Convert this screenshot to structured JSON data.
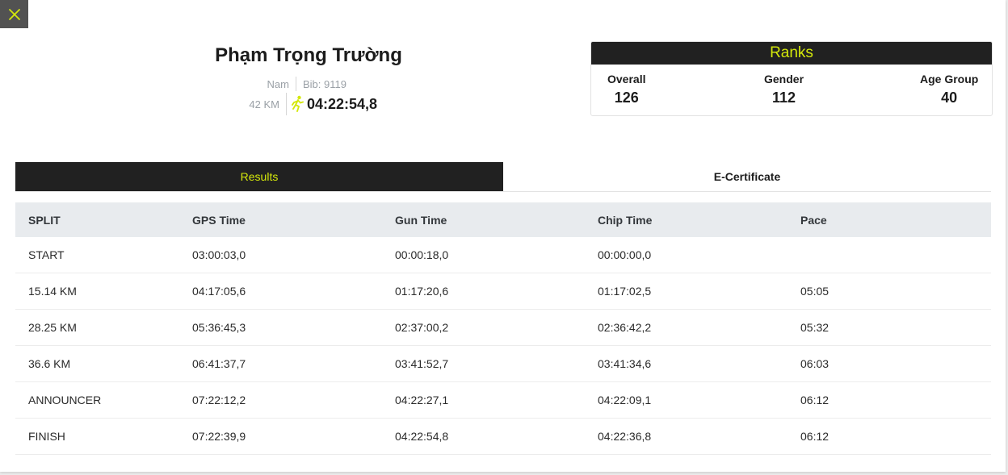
{
  "athlete": {
    "name": "Phạm Trọng Trường",
    "gender": "Nam",
    "bib": "Bib: 9119",
    "distance": "42 KM",
    "finish_time": "04:22:54,8"
  },
  "ranks": {
    "title": "Ranks",
    "items": [
      {
        "label": "Overall",
        "value": "126"
      },
      {
        "label": "Gender",
        "value": "112"
      },
      {
        "label": "Age Group",
        "value": "40"
      }
    ]
  },
  "tabs": [
    {
      "label": "Results",
      "active": true
    },
    {
      "label": "E-Certificate",
      "active": false
    }
  ],
  "table": {
    "headers": [
      "SPLIT",
      "GPS Time",
      "Gun Time",
      "Chip Time",
      "Pace"
    ],
    "rows": [
      [
        "START",
        "03:00:03,0",
        "00:00:18,0",
        "00:00:00,0",
        ""
      ],
      [
        "15.14 KM",
        "04:17:05,6",
        "01:17:20,6",
        "01:17:02,5",
        "05:05"
      ],
      [
        "28.25 KM",
        "05:36:45,3",
        "02:37:00,2",
        "02:36:42,2",
        "05:32"
      ],
      [
        "36.6 KM",
        "06:41:37,7",
        "03:41:52,7",
        "03:41:34,6",
        "06:03"
      ],
      [
        "ANNOUNCER",
        "07:22:12,2",
        "04:22:27,1",
        "04:22:09,1",
        "06:12"
      ],
      [
        "FINISH",
        "07:22:39,9",
        "04:22:54,8",
        "04:22:36,8",
        "06:12"
      ]
    ]
  },
  "icons": {
    "close": "close-icon",
    "runner": "runner-icon"
  },
  "colors": {
    "accent": "#d4e80b",
    "dark": "#212121",
    "table_header_bg": "#e8ebee"
  }
}
